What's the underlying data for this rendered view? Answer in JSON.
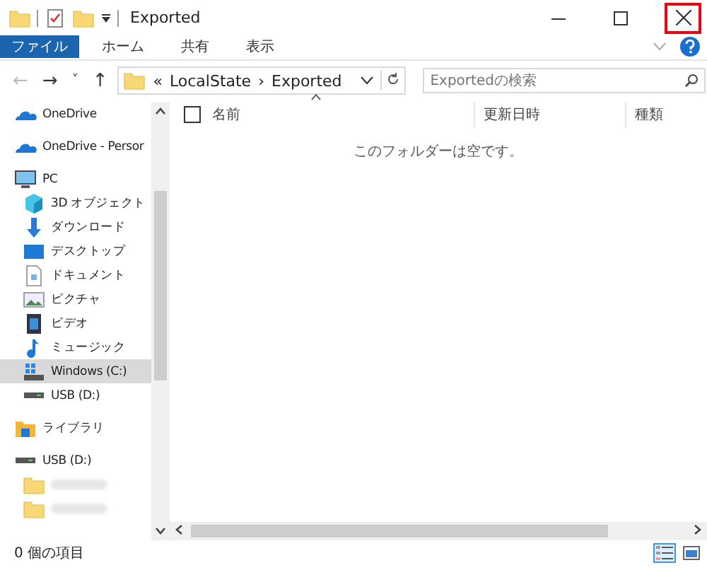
{
  "window": {
    "title": "Exported"
  },
  "ribbon_tabs": [
    {
      "label": "ファイル",
      "selected": true
    },
    {
      "label": "ホーム",
      "selected": false
    },
    {
      "label": "共有",
      "selected": false
    },
    {
      "label": "表示",
      "selected": false
    }
  ],
  "address": {
    "back": "←",
    "forward": "→",
    "recent": "˅",
    "up": "↑",
    "chevron": "«",
    "path": [
      "LocalState",
      "Exported"
    ],
    "separator": "›"
  },
  "search": {
    "placeholder": "Exportedの検索"
  },
  "sidebar": {
    "groups": [
      {
        "items": [
          {
            "label": "OneDrive",
            "kind": "cloud",
            "selected": false
          }
        ]
      },
      {
        "items": [
          {
            "label": "OneDrive - Persor",
            "kind": "cloud",
            "selected": false
          }
        ]
      },
      {
        "items": [
          {
            "label": "PC",
            "kind": "pc",
            "selected": false,
            "children": [
              {
                "label": "3D オブジェクト",
                "kind": "cube",
                "selected": false
              },
              {
                "label": "ダウンロード",
                "kind": "download",
                "selected": false
              },
              {
                "label": "デスクトップ",
                "kind": "desktop",
                "selected": false
              },
              {
                "label": "ドキュメント",
                "kind": "document",
                "selected": false
              },
              {
                "label": "ピクチャ",
                "kind": "pictures",
                "selected": false
              },
              {
                "label": "ビデオ",
                "kind": "video",
                "selected": false
              },
              {
                "label": "ミュージック",
                "kind": "music",
                "selected": false
              },
              {
                "label": "Windows (C:)",
                "kind": "windrive",
                "selected": true
              },
              {
                "label": "USB (D:)",
                "kind": "drive",
                "selected": false
              }
            ]
          }
        ]
      },
      {
        "items": [
          {
            "label": "ライブラリ",
            "kind": "library",
            "selected": false
          }
        ]
      },
      {
        "items": [
          {
            "label": "USB (D:)",
            "kind": "drive",
            "selected": false,
            "children": [
              {
                "kind": "blurred-folder",
                "selected": false
              },
              {
                "kind": "blurred-folder",
                "selected": false
              }
            ]
          }
        ]
      }
    ]
  },
  "table": {
    "select_all_checked": false,
    "columns": [
      "名前",
      "更新日時",
      "種類"
    ],
    "empty_message": "このフォルダーは空です。"
  },
  "status_bar": {
    "item_count": "0 個の項目"
  }
}
